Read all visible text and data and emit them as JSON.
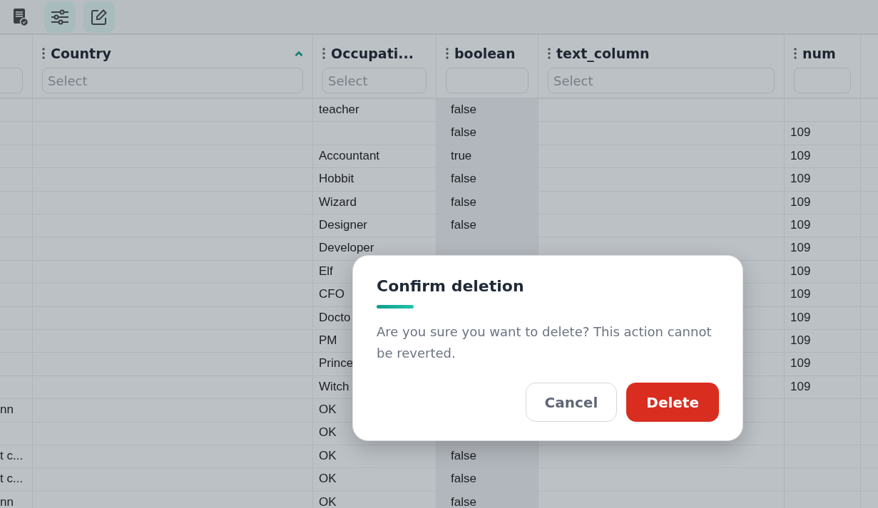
{
  "toolbar": {
    "buttons": [
      {
        "kind": "document",
        "active": false
      },
      {
        "kind": "sliders",
        "active": true
      },
      {
        "kind": "edit",
        "active": true
      }
    ]
  },
  "table": {
    "columns": [
      {
        "kind": "partial",
        "sorted": false
      },
      {
        "kind": "filter",
        "label": "Country",
        "placeholder": "Select",
        "sorted": true
      },
      {
        "kind": "filter",
        "label": "Occupati...",
        "placeholder": "Select",
        "sorted": false
      },
      {
        "kind": "filter",
        "label": "boolean",
        "sorted": false
      },
      {
        "kind": "filter",
        "label": "text_column",
        "placeholder": "Select",
        "sorted": false
      },
      {
        "kind": "filter",
        "label": "num",
        "sorted": false
      },
      {
        "kind": "blank",
        "sorted": false
      }
    ],
    "rows": [
      [
        "",
        "",
        "teacher",
        "false",
        "",
        "",
        ""
      ],
      [
        "",
        "",
        "",
        "false",
        "",
        "109",
        ""
      ],
      [
        "",
        "",
        "Accountant",
        "true",
        "",
        "109",
        ""
      ],
      [
        "",
        "",
        "Hobbit",
        "false",
        "",
        "109",
        ""
      ],
      [
        "",
        "",
        "Wizard",
        "false",
        "",
        "109",
        ""
      ],
      [
        "",
        "",
        "Designer",
        "false",
        "",
        "109",
        ""
      ],
      [
        "",
        "",
        "Developer",
        "",
        "",
        "109",
        ""
      ],
      [
        "",
        "",
        "Elf",
        "",
        "",
        "109",
        ""
      ],
      [
        "",
        "",
        "CFO",
        "",
        "",
        "109",
        ""
      ],
      [
        "",
        "",
        "Docto",
        "",
        "",
        "109",
        ""
      ],
      [
        "",
        "",
        "PM",
        "",
        "",
        "109",
        ""
      ],
      [
        "",
        "",
        "Prince",
        "",
        "",
        "109",
        ""
      ],
      [
        "",
        "",
        "Witch",
        "",
        "",
        "109",
        ""
      ],
      [
        "nn",
        "",
        "OK",
        "",
        "",
        "",
        ""
      ],
      [
        "",
        "",
        "OK",
        "",
        "",
        "",
        ""
      ],
      [
        "t c...",
        "",
        "OK",
        "false",
        "",
        "",
        ""
      ],
      [
        "t c...",
        "",
        "OK",
        "false",
        "",
        "",
        ""
      ],
      [
        "nn",
        "",
        "OK",
        "false",
        "",
        "",
        ""
      ]
    ]
  },
  "dialog": {
    "title": "Confirm deletion",
    "message": "Are you sure you want to delete? This action cannot be reverted.",
    "buttons": [
      {
        "label": "Cancel",
        "kind": "secondary"
      },
      {
        "label": "Delete",
        "kind": "danger"
      }
    ]
  }
}
